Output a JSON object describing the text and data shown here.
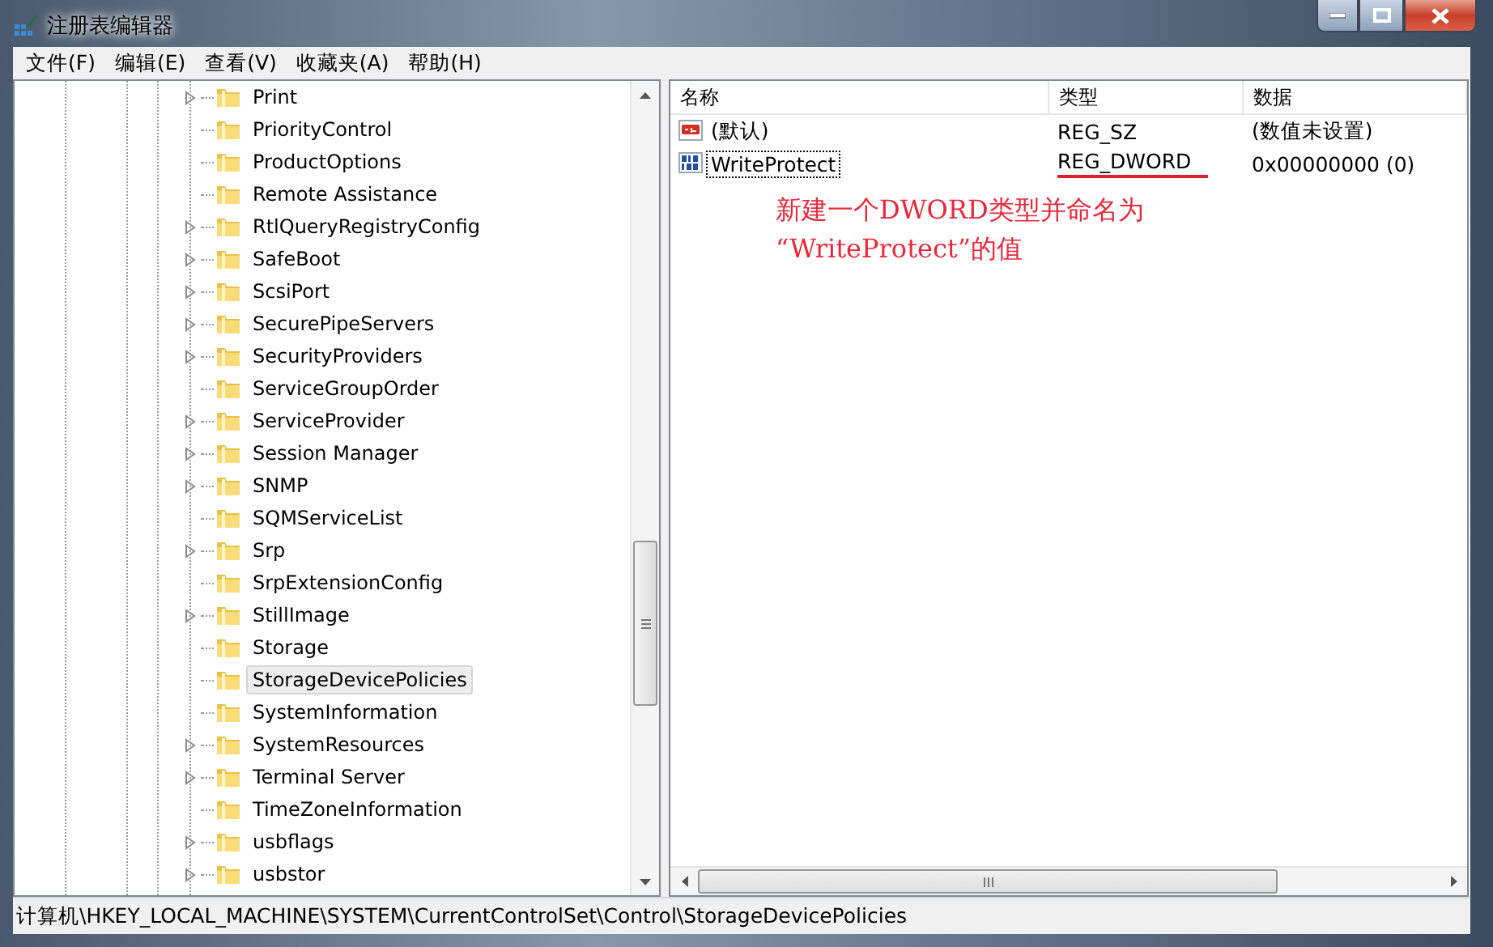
{
  "window": {
    "title": "注册表编辑器"
  },
  "menu": [
    {
      "label": "文件(F)"
    },
    {
      "label": "编辑(E)"
    },
    {
      "label": "查看(V)"
    },
    {
      "label": "收藏夹(A)"
    },
    {
      "label": "帮助(H)"
    }
  ],
  "tree": {
    "items": [
      {
        "label": "Print",
        "expandable": true,
        "selected": false
      },
      {
        "label": "PriorityControl",
        "expandable": false,
        "selected": false
      },
      {
        "label": "ProductOptions",
        "expandable": false,
        "selected": false
      },
      {
        "label": "Remote Assistance",
        "expandable": false,
        "selected": false
      },
      {
        "label": "RtlQueryRegistryConfig",
        "expandable": true,
        "selected": false
      },
      {
        "label": "SafeBoot",
        "expandable": true,
        "selected": false
      },
      {
        "label": "ScsiPort",
        "expandable": true,
        "selected": false
      },
      {
        "label": "SecurePipeServers",
        "expandable": true,
        "selected": false
      },
      {
        "label": "SecurityProviders",
        "expandable": true,
        "selected": false
      },
      {
        "label": "ServiceGroupOrder",
        "expandable": false,
        "selected": false
      },
      {
        "label": "ServiceProvider",
        "expandable": true,
        "selected": false
      },
      {
        "label": "Session Manager",
        "expandable": true,
        "selected": false
      },
      {
        "label": "SNMP",
        "expandable": true,
        "selected": false
      },
      {
        "label": "SQMServiceList",
        "expandable": false,
        "selected": false
      },
      {
        "label": "Srp",
        "expandable": true,
        "selected": false
      },
      {
        "label": "SrpExtensionConfig",
        "expandable": false,
        "selected": false
      },
      {
        "label": "StillImage",
        "expandable": true,
        "selected": false
      },
      {
        "label": "Storage",
        "expandable": false,
        "selected": false
      },
      {
        "label": "StorageDevicePolicies",
        "expandable": false,
        "selected": true
      },
      {
        "label": "SystemInformation",
        "expandable": false,
        "selected": false
      },
      {
        "label": "SystemResources",
        "expandable": true,
        "selected": false
      },
      {
        "label": "Terminal Server",
        "expandable": true,
        "selected": false
      },
      {
        "label": "TimeZoneInformation",
        "expandable": false,
        "selected": false
      },
      {
        "label": "usbflags",
        "expandable": true,
        "selected": false
      },
      {
        "label": "usbstor",
        "expandable": true,
        "selected": false
      }
    ]
  },
  "values": {
    "columns": [
      "名称",
      "类型",
      "数据"
    ],
    "rows": [
      {
        "kind": "string",
        "name": "(默认)",
        "type": "REG_SZ",
        "data": "(数值未设置)",
        "focused": false,
        "highlighted": false
      },
      {
        "kind": "binary",
        "name": "WriteProtect",
        "type": "REG_DWORD",
        "data": "0x00000000 (0)",
        "focused": true,
        "highlighted": true
      }
    ]
  },
  "annotation": {
    "lines": [
      "新建一个DWORD类型并命名为",
      "“WriteProtect”的值"
    ]
  },
  "status_bar": {
    "path": "计算机\\HKEY_LOCAL_MACHINE\\SYSTEM\\CurrentControlSet\\Control\\StorageDevicePolicies"
  }
}
